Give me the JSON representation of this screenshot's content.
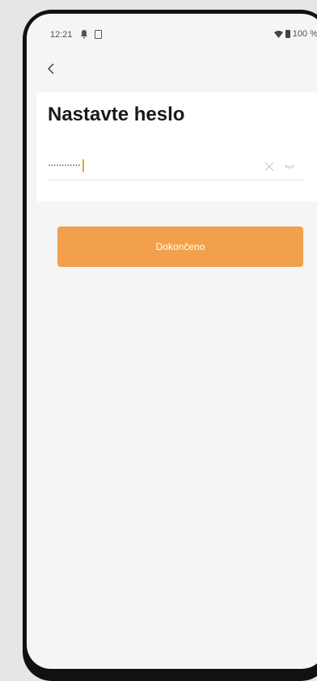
{
  "status_bar": {
    "time": "12:21",
    "battery": "100 %",
    "icons": [
      "notification-bell-icon",
      "sim-card-icon",
      "wifi-icon",
      "battery-icon"
    ]
  },
  "navigation": {
    "back_icon": "chevron-left-icon"
  },
  "form": {
    "title": "Nastavte heslo",
    "password_value": "············",
    "clear_icon": "close-icon",
    "visibility_icon": "eye-closed-icon"
  },
  "actions": {
    "done_label": "Dokončeno"
  },
  "colors": {
    "accent": "#f3a04c",
    "caret": "#f09a4a",
    "background": "#f5f5f5",
    "card": "#ffffff"
  }
}
